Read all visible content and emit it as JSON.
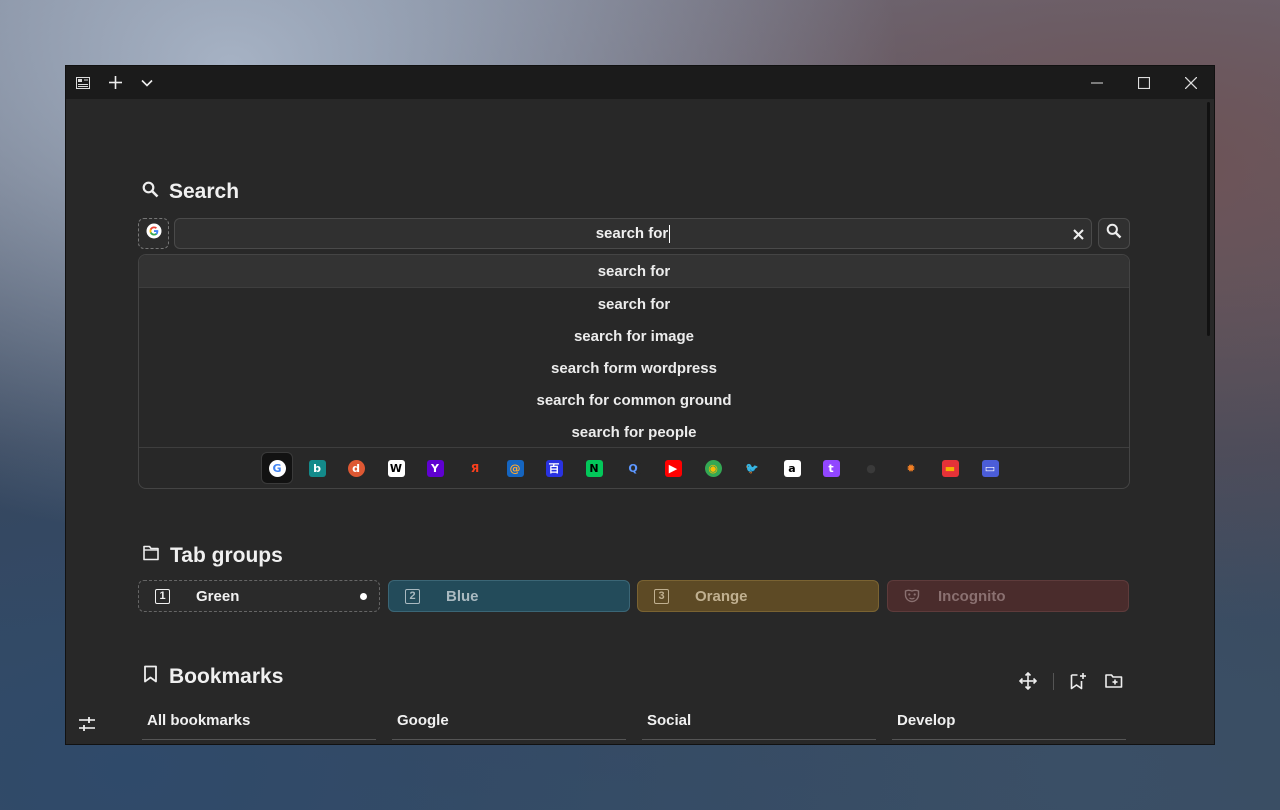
{
  "titlebar": {
    "sidebar_icon": "sidebar-icon",
    "new_tab_icon": "plus-icon",
    "tabs_menu_icon": "chevron-down-icon",
    "minimize_icon": "minimize-icon",
    "maximize_icon": "maximize-icon",
    "close_icon": "close-icon"
  },
  "search": {
    "title": "Search",
    "query": "search for",
    "suggestions": [
      "search for",
      "search for",
      "search for image",
      "search form wordpress",
      "search for common ground",
      "search for people"
    ],
    "engines": [
      {
        "name": "google",
        "label": "G",
        "color": "#ffffff",
        "fg": "#4285f4"
      },
      {
        "name": "bing",
        "label": "b",
        "color": "#138a8a",
        "fg": "#ffffff"
      },
      {
        "name": "duckduckgo",
        "label": "d",
        "color": "#de5833",
        "fg": "#ffffff"
      },
      {
        "name": "wikipedia",
        "label": "W",
        "color": "#ffffff",
        "fg": "#000000"
      },
      {
        "name": "yahoo",
        "label": "Y",
        "color": "#5f01d1",
        "fg": "#ffffff"
      },
      {
        "name": "yandex",
        "label": "Я",
        "color": "#282828",
        "fg": "#fc3f1d"
      },
      {
        "name": "mail-ru",
        "label": "@",
        "color": "#1565c0",
        "fg": "#ffa930"
      },
      {
        "name": "baidu",
        "label": "百",
        "color": "#2932e1",
        "fg": "#ffffff"
      },
      {
        "name": "naver",
        "label": "N",
        "color": "#03c75a",
        "fg": "#000000"
      },
      {
        "name": "qwant",
        "label": "Q",
        "color": "#282828",
        "fg": "#5c97ff"
      },
      {
        "name": "youtube",
        "label": "▶",
        "color": "#ff0000",
        "fg": "#ffffff"
      },
      {
        "name": "google-maps",
        "label": "◉",
        "color": "#34a853",
        "fg": "#fbbc04"
      },
      {
        "name": "twitter",
        "label": "🐦",
        "color": "#282828",
        "fg": "#1d9bf0"
      },
      {
        "name": "amazon",
        "label": "a",
        "color": "#ffffff",
        "fg": "#000000"
      },
      {
        "name": "twitch",
        "label": "t",
        "color": "#9146ff",
        "fg": "#ffffff"
      },
      {
        "name": "github",
        "label": "●",
        "color": "#282828",
        "fg": "#3a3a3a"
      },
      {
        "name": "stack-overflow",
        "label": "✹",
        "color": "#282828",
        "fg": "#f48024"
      },
      {
        "name": "ebay",
        "label": "▬",
        "color": "#e53238",
        "fg": "#f5af02"
      },
      {
        "name": "custom-engine",
        "label": "▭",
        "color": "#4b5dd8",
        "fg": "#ffffff"
      }
    ]
  },
  "tab_groups": {
    "title": "Tab groups",
    "groups": [
      {
        "number": "1",
        "label": "Green",
        "bg": "#2a2a2a",
        "fg": "#f0f0f0",
        "border": "#666",
        "dashed": true,
        "active": true
      },
      {
        "number": "2",
        "label": "Blue",
        "bg": "#234b5a",
        "fg": "#a9b9c0",
        "border": "#3b6676",
        "dashed": false,
        "active": false
      },
      {
        "number": "3",
        "label": "Orange",
        "bg": "#5d4a25",
        "fg": "#c0b090",
        "border": "#7a6332",
        "dashed": false,
        "active": false
      },
      {
        "number": "",
        "label": "Incognito",
        "bg": "#4a2c2c",
        "fg": "#8a7070",
        "border": "#5e3b3b",
        "dashed": false,
        "active": false
      }
    ]
  },
  "bookmarks": {
    "title": "Bookmarks",
    "tabs": [
      "All bookmarks",
      "Google",
      "Social",
      "Develop"
    ]
  },
  "colors": {
    "window_bg": "#282828",
    "titlebar_bg": "#1b1b1b",
    "text": "#f0f0f0"
  }
}
